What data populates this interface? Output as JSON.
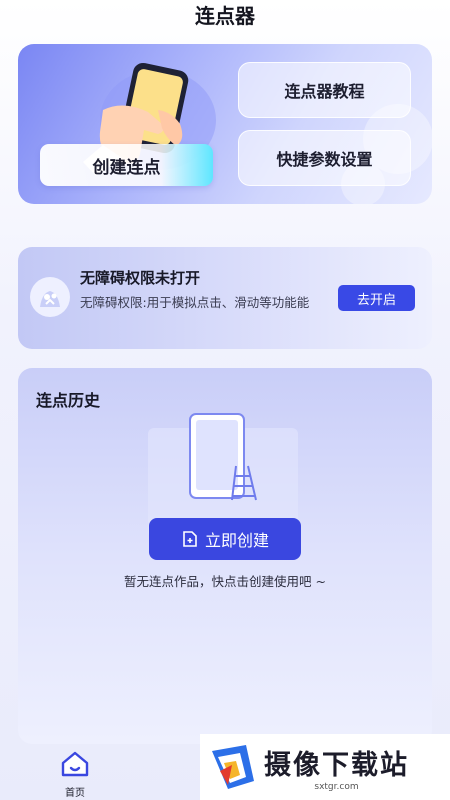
{
  "header": {
    "title": "连点器"
  },
  "top_card": {
    "create_label": "创建连点",
    "tutorial_label": "连点器教程",
    "settings_label": "快捷参数设置"
  },
  "permission": {
    "title": "无障碍权限未打开",
    "description": "无障碍权限:用于模拟点击、滑动等功能能",
    "button_label": "去开启"
  },
  "history": {
    "title": "连点历史",
    "create_now_label": "立即创建",
    "empty_text": "暂无连点作品，快点击创建使用吧 ~"
  },
  "bottom_nav": {
    "items": [
      {
        "label": "首页",
        "icon": "home-icon"
      }
    ]
  },
  "watermark": {
    "title": "摄像下载站",
    "url": "sxtgr.com"
  },
  "colors": {
    "accent": "#3a47e0",
    "button_blue": "#3949e6",
    "cyan": "#5ee6ff"
  }
}
